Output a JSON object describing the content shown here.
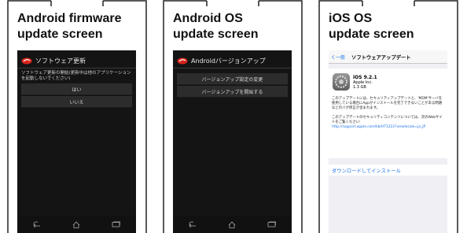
{
  "panels": [
    {
      "caption": "Android firmware\nupdate screen",
      "title": "ソフトウェア更新",
      "message": "ソフトウェア更新の開始(更新中は他のアプリケーションを起動しないでください)",
      "buttons": [
        "はい",
        "いいえ"
      ]
    },
    {
      "caption": "Android OS\nupdate screen",
      "title": "Androidバージョンアップ",
      "buttons": [
        "バージョンアップ設定の変更",
        "バージョンアップを開始する"
      ]
    },
    {
      "caption": "iOS OS\nupdate screen",
      "back": "く一般",
      "nav_title": "ソフトウェアアップデート",
      "version": "iOS 9.2.1",
      "company": "Apple Inc.",
      "size": "1.3 GB",
      "description": "このアップデートには、セキュリティアップデートと、'MDM'サーバを使用している場合にAppがインストールを完了できないことがある問題などのバグ修正が含まれます。",
      "security_note": "このアップデートのセキュリティコンテンツについては、次のWebサイトをご覧ください:",
      "link": "http://support.apple.com/kb/HT1222?viewlocale=ja_JP",
      "download_label": "ダウンロードしてインストール"
    }
  ],
  "colors": {
    "android_bg": "#141414",
    "ios_bg": "#efeff4",
    "ios_link": "#1a73e8",
    "logo_red": "#d9251c"
  }
}
